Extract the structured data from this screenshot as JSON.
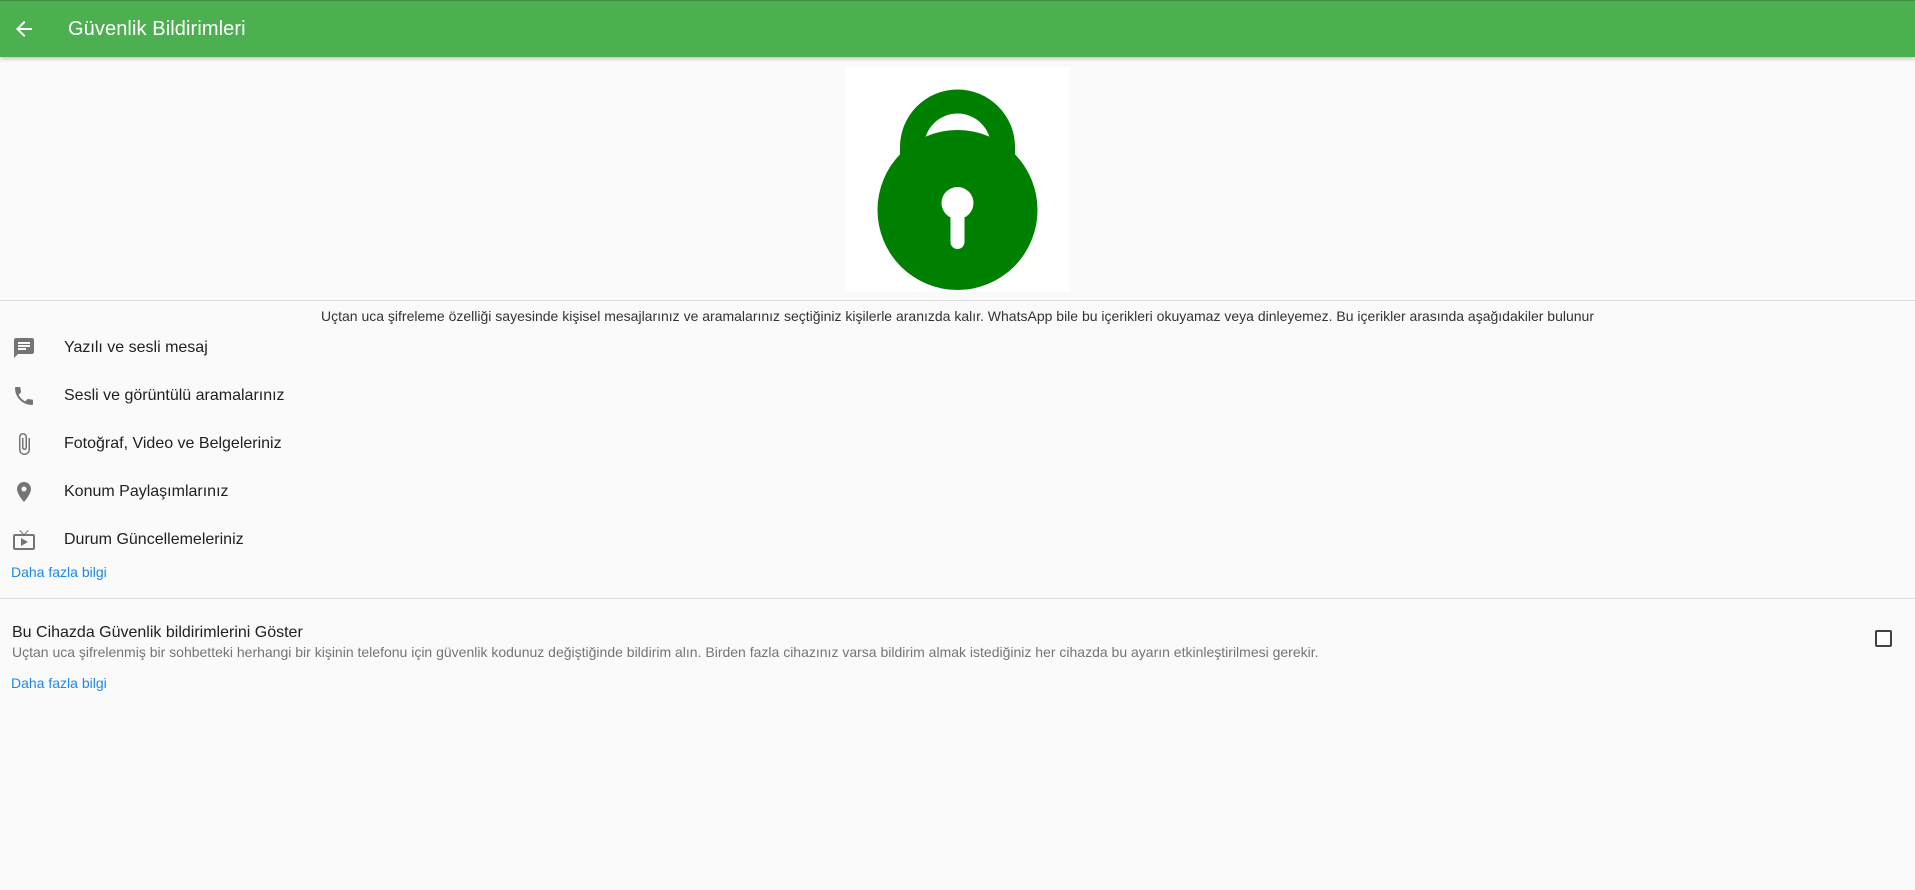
{
  "app_bar": {
    "title": "Güvenlik Bildirimleri",
    "background": "#4caf50",
    "back_icon": "arrow-left-icon"
  },
  "hero": {
    "icon": "padlock-icon",
    "icon_color": "#008000"
  },
  "intro_text": "Uçtan uca şifreleme özelliği sayesinde kişisel mesajlarınız ve aramalarınız seçtiğiniz kişilerle aranızda kalır. WhatsApp bile bu içerikleri okuyamaz veya dinleyemez. Bu içerikler arasında aşağıdakiler bulunur",
  "features": [
    {
      "icon": "message-icon",
      "label": "Yazılı ve sesli mesaj"
    },
    {
      "icon": "phone-icon",
      "label": "Sesli ve görüntülü aramalarınız"
    },
    {
      "icon": "attachment-icon",
      "label": "Fotoğraf, Video ve Belgeleriniz"
    },
    {
      "icon": "location-pin-icon",
      "label": "Konum Paylaşımlarınız"
    },
    {
      "icon": "status-tv-icon",
      "label": "Durum Güncellemeleriniz"
    }
  ],
  "learn_more_1": "Daha fazla bilgi",
  "setting": {
    "title": "Bu Cihazda Güvenlik bildirimlerini Göster",
    "description": "Uçtan uca şifrelenmiş bir sohbetteki herhangi bir kişinin telefonu için güvenlik kodunuz değiştiğinde bildirim alın. Birden fazla cihazınız varsa bildirim almak istediğiniz her cihazda bu ayarın etkinleştirilmesi gerekir.",
    "checked": false
  },
  "learn_more_2": "Daha fazla bilgi",
  "colors": {
    "link": "#1e88e5",
    "icon_grey": "#757575"
  }
}
